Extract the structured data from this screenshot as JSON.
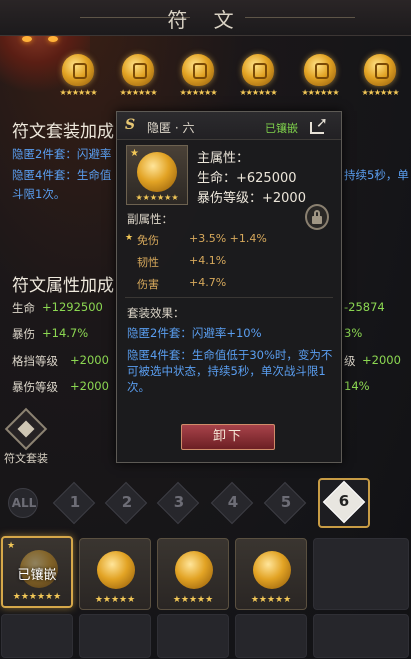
{
  "header": {
    "title": "符 文"
  },
  "rune_row": [
    {
      "stars": "★★★★★★"
    },
    {
      "stars": "★★★★★★"
    },
    {
      "stars": "★★★★★★"
    },
    {
      "stars": "★★★★★★"
    },
    {
      "stars": "★★★★★★"
    },
    {
      "stars": "★★★★★★"
    }
  ],
  "set_bonus": {
    "title": "符文套装加成",
    "line1": "隐匿2件套：闪避率",
    "line2": "隐匿4件套：生命值",
    "line2_right": "持续5秒，单",
    "line3": "斗限1次。"
  },
  "attr_section": {
    "title": "符文属性加成",
    "rows": [
      {
        "label": "生命",
        "value": "+1292500",
        "right": "-25874"
      },
      {
        "label": "暴伤",
        "value": "+14.7%",
        "right": "3%"
      },
      {
        "label": "格挡等级",
        "value": "+2000",
        "right_label": "级",
        "right": "+2000"
      },
      {
        "label": "暴伤等级",
        "value": "+2000",
        "right": "14%"
      }
    ]
  },
  "side_button": {
    "label": "符文套装"
  },
  "tabs": [
    "ALL",
    "1",
    "2",
    "3",
    "4",
    "5",
    "6"
  ],
  "grid": {
    "selected_label": "已镶嵌",
    "items": [
      {
        "stars": "★★★★★★"
      },
      {
        "stars": "★★★★★"
      },
      {
        "stars": "★★★★★"
      },
      {
        "stars": "★★★★★"
      }
    ]
  },
  "popup": {
    "logo": "S",
    "title": "隐匿 · 六",
    "status": "已镶嵌",
    "gem_stars": "★★★★★★",
    "main_attr_title": "主属性：",
    "main_attr_1": "生命：+625000",
    "main_attr_2": "暴伤等级：+2000",
    "sub_attr_title": "副属性：",
    "sub_attrs": [
      {
        "label": "免伤",
        "value": "+3.5% +1.4%",
        "star": "★"
      },
      {
        "label": "韧性",
        "value": "+4.1%",
        "star": ""
      },
      {
        "label": "伤害",
        "value": "+4.7%",
        "star": ""
      }
    ],
    "set_effect_title": "套装效果：",
    "set_2": "隐匿2件套：闪避率+10%",
    "set_4": "隐匿4件套：生命值低于30%时，变为不可被选中状态，持续5秒，单次战斗限1次。",
    "unequip_label": "卸下"
  }
}
